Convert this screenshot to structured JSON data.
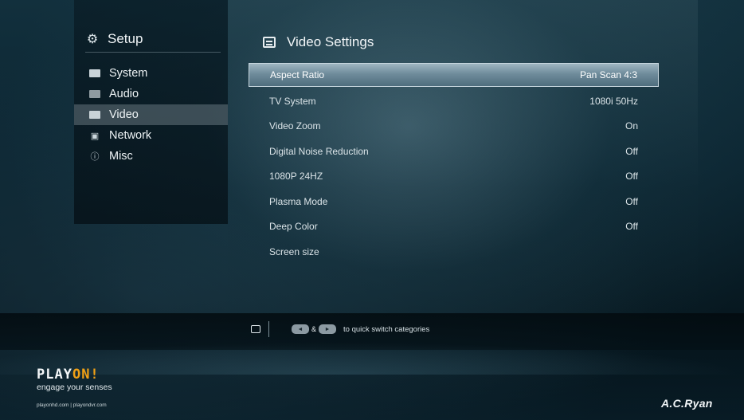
{
  "sidebar": {
    "title": "Setup",
    "title_icon": "gear-icon",
    "items": [
      {
        "label": "System",
        "icon": "system-icon",
        "active": false
      },
      {
        "label": "Audio",
        "icon": "audio-icon",
        "active": false
      },
      {
        "label": "Video",
        "icon": "video-icon",
        "active": true
      },
      {
        "label": "Network",
        "icon": "network-icon",
        "active": false
      },
      {
        "label": "Misc",
        "icon": "misc-icon",
        "active": false
      }
    ]
  },
  "main": {
    "title": "Video Settings",
    "title_icon": "video-settings-icon",
    "settings": [
      {
        "label": "Aspect Ratio",
        "value": "Pan Scan 4:3",
        "selected": true
      },
      {
        "label": "TV System",
        "value": "1080i 50Hz",
        "selected": false
      },
      {
        "label": "Video Zoom",
        "value": "On",
        "selected": false
      },
      {
        "label": "Digital Noise Reduction",
        "value": "Off",
        "selected": false
      },
      {
        "label": "1080P 24HZ",
        "value": "Off",
        "selected": false
      },
      {
        "label": "Plasma Mode",
        "value": "Off",
        "selected": false
      },
      {
        "label": "Deep Color",
        "value": "Off",
        "selected": false
      },
      {
        "label": "Screen size",
        "value": "",
        "selected": false
      }
    ]
  },
  "hint": {
    "amp": "&",
    "text": "to quick switch categories",
    "left_key": "◄",
    "right_key": "►"
  },
  "footer": {
    "logo_main_a": "PLAY",
    "logo_main_b": "ON!",
    "logo_sub": "engage your senses",
    "links": "playonhd.com | playondvr.com",
    "brand": "A.C.Ryan"
  },
  "colors": {
    "selection": "#6f8c9b",
    "logo_accent": "#f0a015"
  }
}
